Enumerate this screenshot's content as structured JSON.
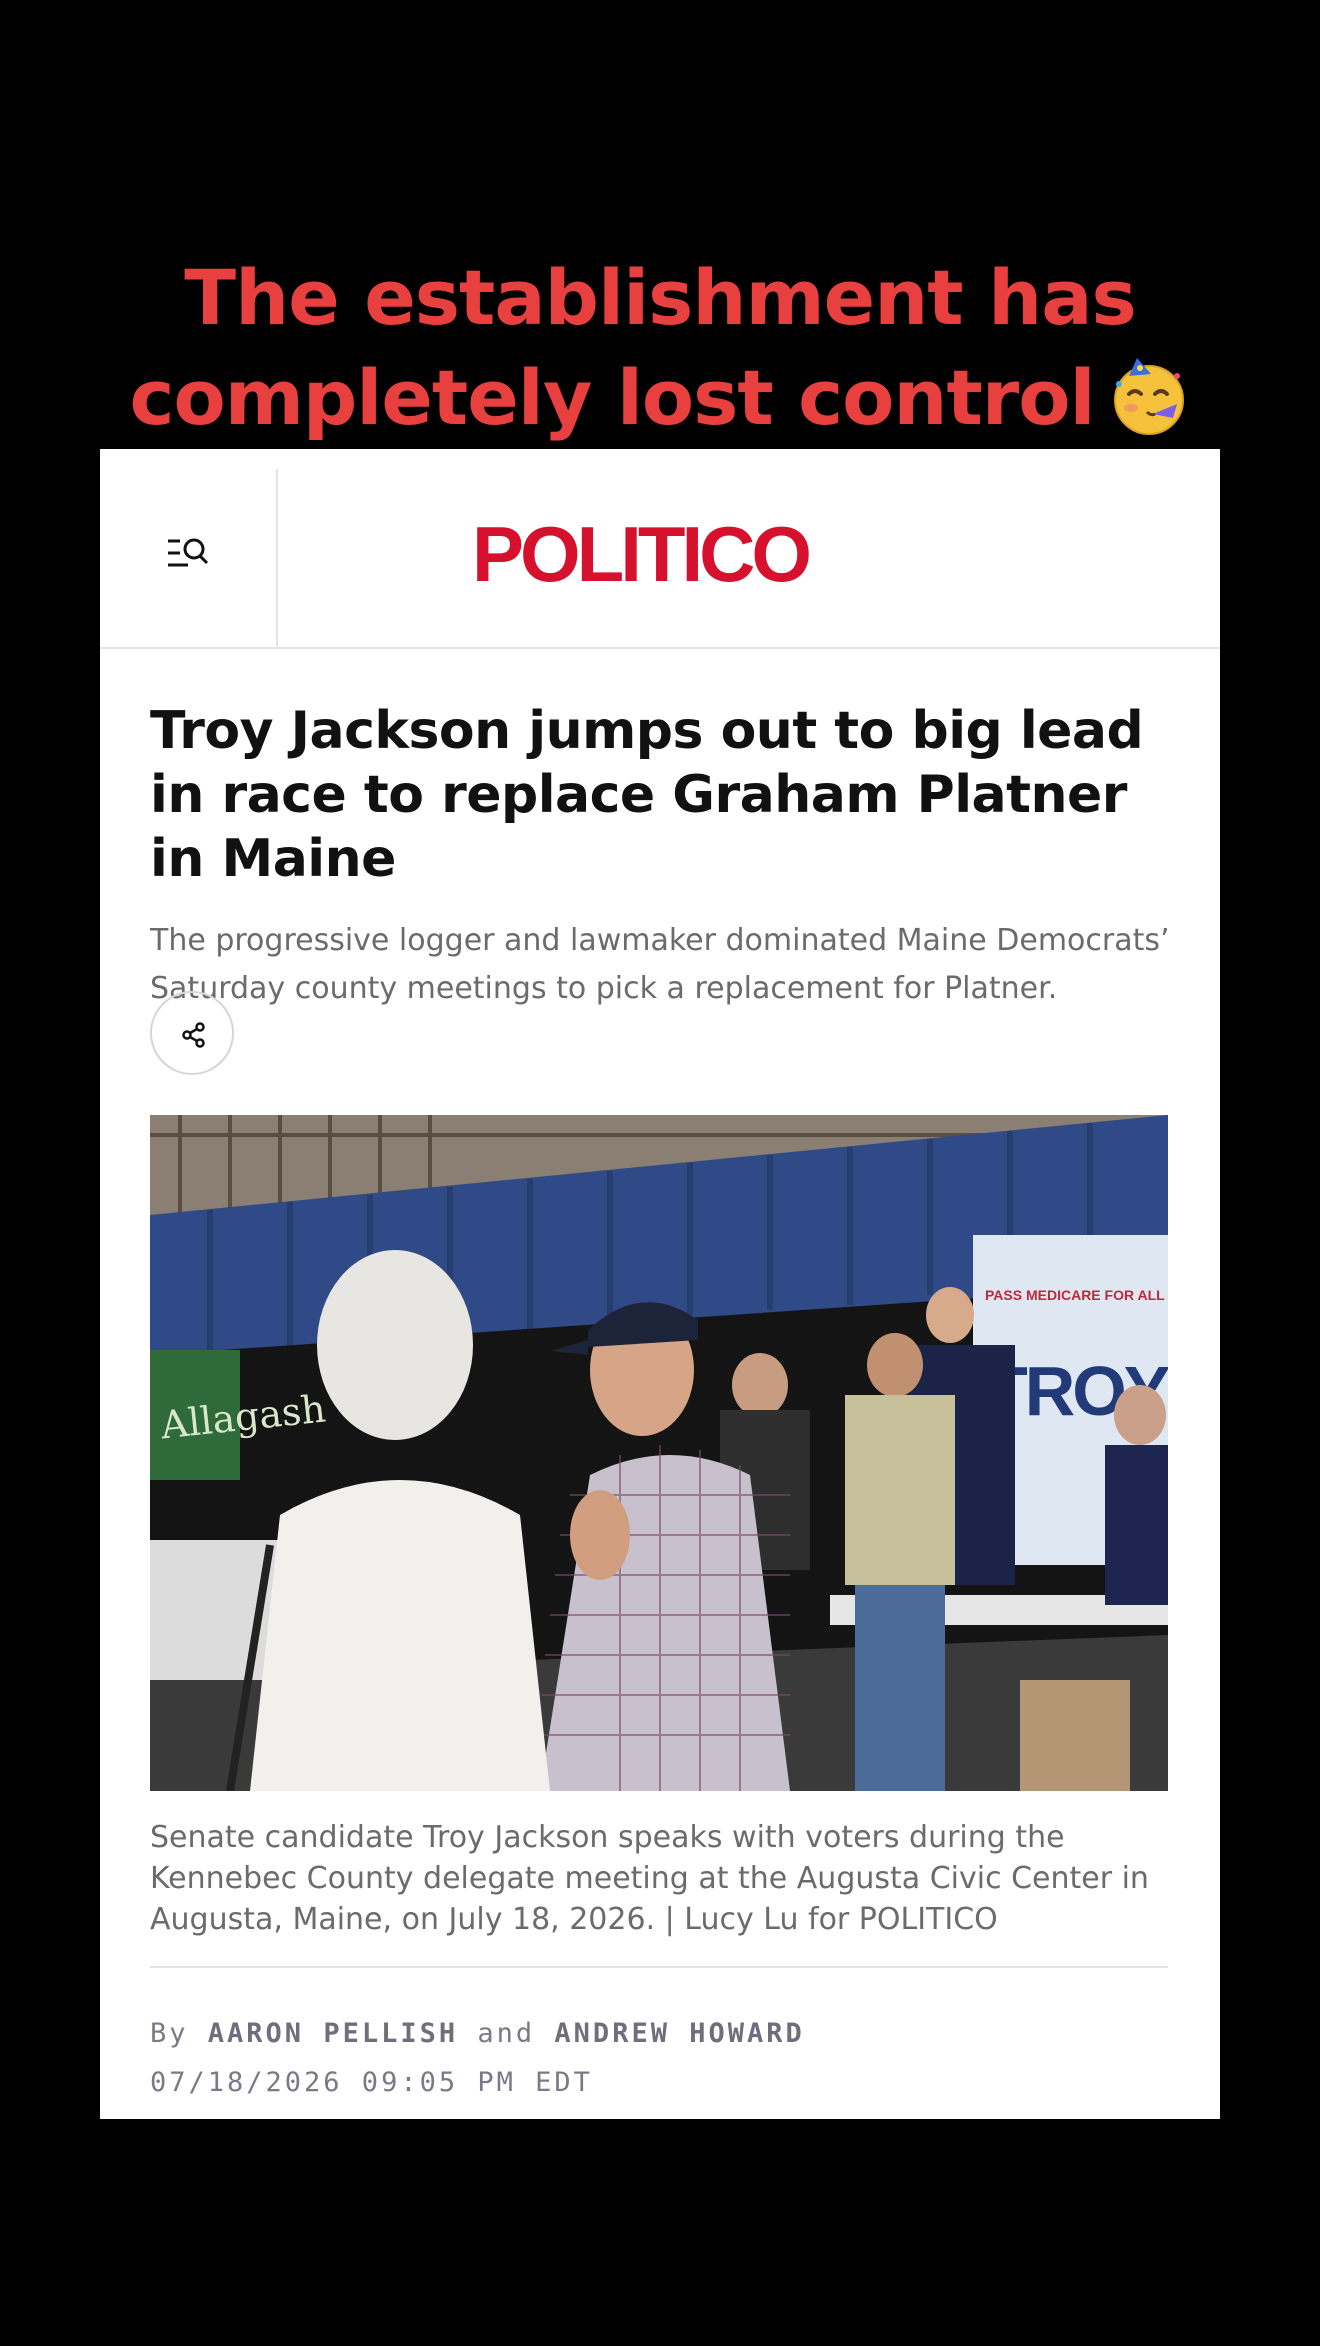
{
  "overlay": {
    "line1": "The establishment has",
    "line2": "completely lost control",
    "emoji": "partying-face-emoji"
  },
  "header": {
    "menu_icon": "menu-search-icon",
    "logo_text": "POLITICO"
  },
  "article": {
    "headline": "Troy Jackson jumps out to big lead in race to replace Graham Platner in Maine",
    "dek": "The progressive logger and lawmaker dominated Maine Democrats’ Saturday county meetings to pick a replacement for Platner.",
    "share_icon": "share-icon",
    "photo_caption": "Senate candidate Troy Jackson speaks with voters during the Kennebec County delegate meeting at the Augusta Civic Center in Augusta, Maine, on July 18, 2026. | Lucy Lu for POLITICO",
    "photo_sign_text": "PASS MEDICARE FOR ALL",
    "photo_banner_text": "TROY JACKSON",
    "photo_left_sign": "Allagash",
    "byline": {
      "prefix": "By",
      "author1": "AARON PELLISH",
      "conj": "and",
      "author2": "ANDREW HOWARD"
    },
    "timestamp": "07/18/2026 09:05 PM EDT"
  },
  "colors": {
    "overlay_text": "#e8403f",
    "brand": "#d6112e",
    "background": "#000000"
  }
}
